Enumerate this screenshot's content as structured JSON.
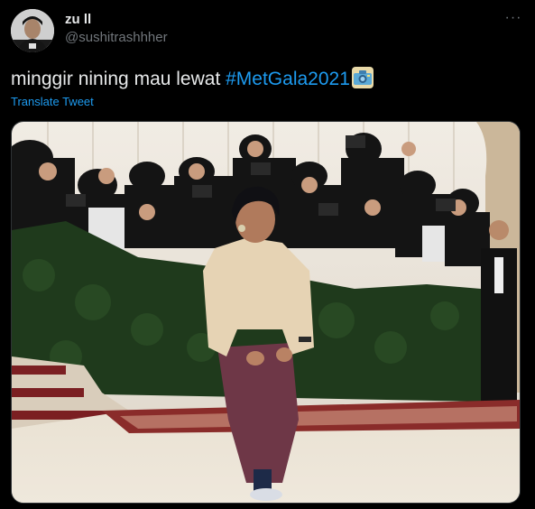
{
  "tweet": {
    "display_name": "zu ll",
    "handle": "@sushitrashhher",
    "text_plain": "minggir nining mau lewat ",
    "hashtag": "#MetGala2021",
    "emoji_icon": "camera-emoji-icon",
    "translate_label": "Translate Tweet",
    "more_label": "···"
  },
  "colors": {
    "background": "#000000",
    "text": "#e7e9ea",
    "secondary": "#71767b",
    "link": "#1d9bf0"
  }
}
